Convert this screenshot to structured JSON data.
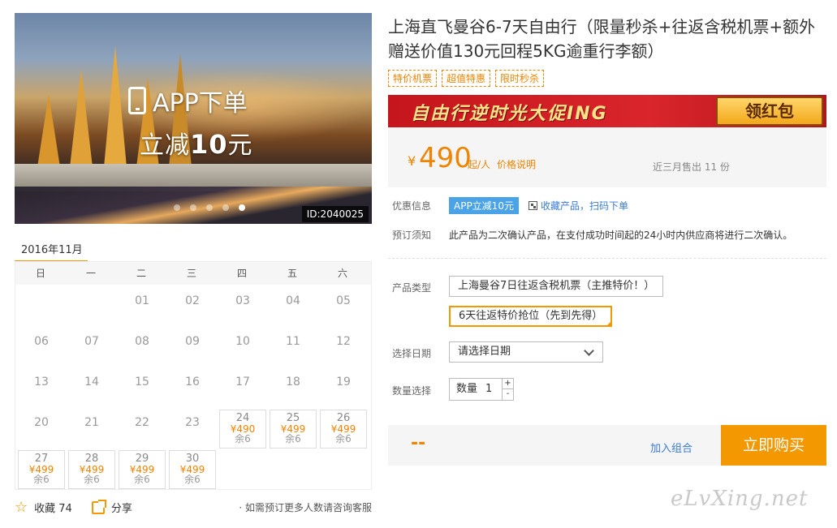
{
  "hero": {
    "promo_line1": "APP下单",
    "promo_line2_prefix": "立减",
    "promo_line2_amount": "10",
    "promo_line2_suffix": "元",
    "id_badge": "ID:2040025"
  },
  "calendar": {
    "month_label": "2016年11月",
    "weekdays": [
      "日",
      "一",
      "二",
      "三",
      "四",
      "五",
      "六"
    ],
    "days": [
      {
        "d": "01"
      },
      {
        "d": "02"
      },
      {
        "d": "03"
      },
      {
        "d": "04"
      },
      {
        "d": "05"
      },
      {
        "d": "06"
      },
      {
        "d": "07"
      },
      {
        "d": "08"
      },
      {
        "d": "09"
      },
      {
        "d": "10"
      },
      {
        "d": "11"
      },
      {
        "d": "12"
      },
      {
        "d": "13"
      },
      {
        "d": "14"
      },
      {
        "d": "15"
      },
      {
        "d": "16"
      },
      {
        "d": "17"
      },
      {
        "d": "18"
      },
      {
        "d": "19"
      },
      {
        "d": "20"
      },
      {
        "d": "21"
      },
      {
        "d": "22"
      },
      {
        "d": "23"
      },
      {
        "d": "24",
        "price": "¥490",
        "remain": "余6"
      },
      {
        "d": "25",
        "price": "¥499",
        "remain": "余6"
      },
      {
        "d": "26",
        "price": "¥499",
        "remain": "余6"
      },
      {
        "d": "27",
        "price": "¥499",
        "remain": "余6"
      },
      {
        "d": "28",
        "price": "¥499",
        "remain": "余6"
      },
      {
        "d": "29",
        "price": "¥499",
        "remain": "余6"
      },
      {
        "d": "30",
        "price": "¥499",
        "remain": "余6"
      }
    ]
  },
  "actions": {
    "favorite_label": "收藏 74",
    "share_label": "分享",
    "consult_text": "· 如需预订更多人数请咨询客服"
  },
  "product": {
    "title": "上海直飞曼谷6-7天自由行（限量秒杀+往返含税机票+额外赠送价值130元回程5KG逾重行李额）",
    "tags": [
      "特价机票",
      "超值特惠",
      "限时秒杀"
    ],
    "banner_text": "自由行逆时光大促ING",
    "banner_button": "领红包",
    "price_currency": "¥",
    "price_amount": "490",
    "price_unit": "起/人",
    "price_explain": "价格说明",
    "sold_text": "近三月售出 11 份"
  },
  "info": {
    "discount_label": "优惠信息",
    "app_badge": "APP立减10元",
    "qr_link": "收藏产品，扫码下单",
    "notice_label": "预订须知",
    "notice_text": "此产品为二次确认产品，在支付成功时间起的24小时内供应商将进行二次确认。"
  },
  "options": {
    "type_label": "产品类型",
    "type_options": [
      "上海曼谷7日往返含税机票（主推特价！）",
      "6天往返特价抢位（先到先得）"
    ],
    "date_label": "选择日期",
    "date_placeholder": "请选择日期",
    "qty_label": "数量选择",
    "qty_prefix": "数量",
    "qty_value": "1",
    "qty_plus": "+",
    "qty_minus": "-"
  },
  "buybar": {
    "total": "--",
    "combo_label": "加入组合",
    "buy_label": "立即购买"
  },
  "watermark": "eLvXing.net",
  "colors": {
    "accent": "#f39800",
    "price": "#f08300",
    "link": "#3a7bd5",
    "badge_blue": "#4aa3e6",
    "banner_red": "#c4161c"
  }
}
